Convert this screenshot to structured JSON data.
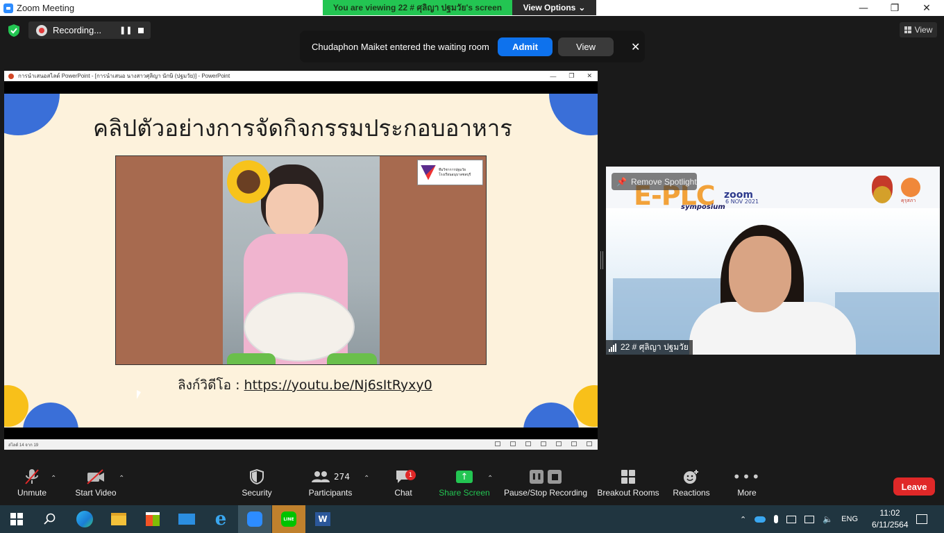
{
  "window": {
    "title": "Zoom Meeting"
  },
  "banner": {
    "viewing_text": "You are viewing 22 # ศุลิญา ปฐมวัย's screen",
    "view_options": "View Options"
  },
  "recording": {
    "label": "Recording..."
  },
  "top_right": {
    "view_label": "View"
  },
  "waiting_room": {
    "message": "Chudaphon Maiket entered the waiting room",
    "admit": "Admit",
    "view": "View"
  },
  "powerpoint": {
    "title": "การนำเสนอสไลด์ PowerPoint - [การนำเสนอ นางสาวศุลิญา นักษิ (ปฐมวัย)] - PowerPoint",
    "slide_title": "คลิปตัวอย่างการจัดกิจกรรมประกอบอาหาร",
    "link_label": "ลิงก์วิดีโอ : ",
    "link_url": "https://youtu.be/Nj6sItRyxy0",
    "logo_text_1": "ทีมวิชาการปฐมวัย",
    "logo_text_2": "โรงเรียนอนุบาลชลบุรี",
    "status": "สไลด์ 14 จาก 19"
  },
  "video_tile": {
    "spotlight_label": "Remove Spotlight",
    "participant_name": "22 # ศุลิญา  ปฐมวัย",
    "event_title": "E-PLC",
    "event_sub": "symposium",
    "zoom_logo": "zoom",
    "event_date": "6 NOV 2021",
    "org_label": "คุรุสภา"
  },
  "toolbar": {
    "unmute": "Unmute",
    "start_video": "Start Video",
    "security": "Security",
    "participants": "Participants",
    "participants_count": "274",
    "chat": "Chat",
    "chat_badge": "1",
    "share_screen": "Share Screen",
    "pause_stop": "Pause/Stop Recording",
    "breakout": "Breakout Rooms",
    "reactions": "Reactions",
    "more": "More",
    "leave": "Leave"
  },
  "taskbar": {
    "lang": "ENG",
    "time": "11:02",
    "date": "6/11/2564"
  },
  "colors": {
    "accent_blue": "#0e72ed",
    "share_green": "#23c552",
    "leave_red": "#e02828",
    "slide_bg": "#fdf2dc",
    "circle_blue": "#3a6fd8",
    "circle_yellow": "#f8c01a"
  }
}
